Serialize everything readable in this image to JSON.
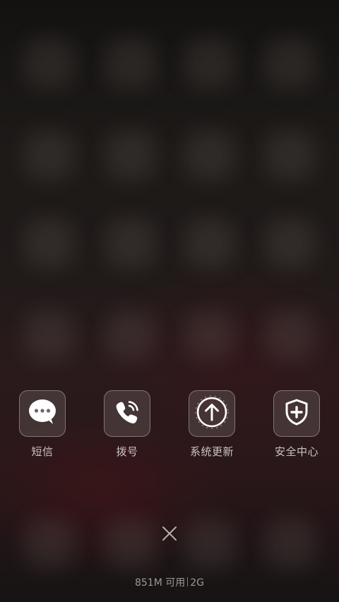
{
  "quick_actions": [
    {
      "label": "短信",
      "icon": "message-bubble-icon"
    },
    {
      "label": "拨号",
      "icon": "phone-icon"
    },
    {
      "label": "系统更新",
      "icon": "upload-arrow-icon"
    },
    {
      "label": "安全中心",
      "icon": "shield-plus-icon"
    }
  ],
  "close": {
    "icon": "close-icon"
  },
  "memory": {
    "available": "851M 可用",
    "total": "2G"
  },
  "colors": {
    "tile_border": "#ffffff",
    "label": "#e6e1e1"
  }
}
